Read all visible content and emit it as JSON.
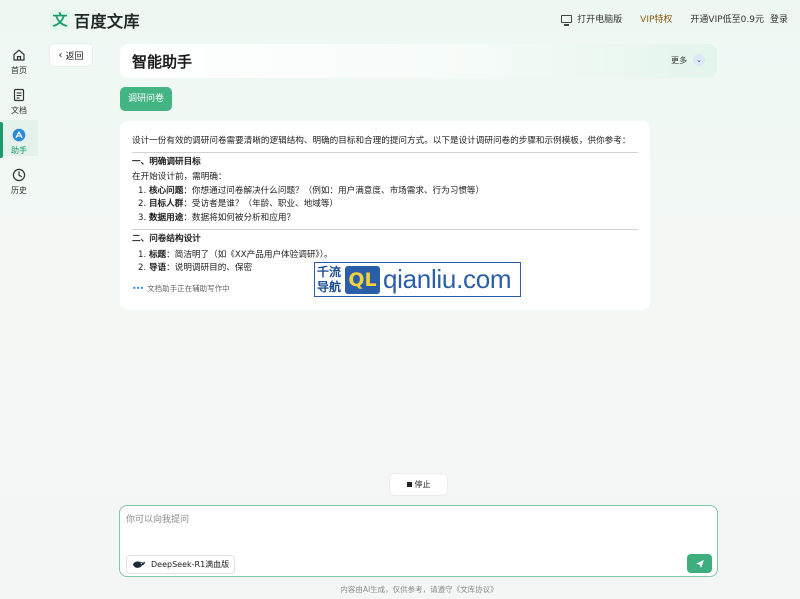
{
  "header": {
    "logo_mark": "文",
    "logo_text": "百度文库",
    "open_pc": "打开电脑版",
    "vip_privilege": "VIP特权",
    "vip_offer": "开通VIP低至0.9元",
    "login": "登录"
  },
  "sidebar": {
    "items": [
      {
        "label": "首页",
        "icon": "home-icon"
      },
      {
        "label": "文档",
        "icon": "document-icon"
      },
      {
        "label": "助手",
        "icon": "assistant-icon",
        "active": true
      },
      {
        "label": "历史",
        "icon": "history-icon"
      }
    ]
  },
  "back_label": "返回",
  "page_title": "智能助手",
  "more_label": "更多",
  "survey_tag": "调研问卷",
  "response": {
    "intro": "设计一份有效的调研问卷需要清晰的逻辑结构、明确的目标和合理的提问方式。以下是设计调研问卷的步骤和示例模板，供你参考：",
    "section1_title": "一、明确调研目标",
    "section1_lead": "在开始设计前，需明确：",
    "section1_items": [
      {
        "num": "1.",
        "term": "核心问题",
        "text": "：你想通过问卷解决什么问题？（例如：用户满意度、市场需求、行为习惯等）"
      },
      {
        "num": "2.",
        "term": "目标人群",
        "text": "：受访者是谁？（年龄、职业、地域等）"
      },
      {
        "num": "3.",
        "term": "数据用途",
        "text": "：数据将如何被分析和应用？"
      }
    ],
    "section2_title": "二、问卷结构设计",
    "section2_items": [
      {
        "num": "1.",
        "term": "标题",
        "text": "：简洁明了（如《XX产品用户体验调研》）。"
      },
      {
        "num": "2.",
        "term": "导语",
        "text": "：说明调研目的、保密"
      }
    ],
    "writing_status": "文档助手正在辅助写作中"
  },
  "watermark": {
    "cn_line1": "千流",
    "cn_line2": "导航",
    "logo": "QL",
    "url": "qianliu.com"
  },
  "stop_label": "停止",
  "input": {
    "placeholder": "你可以向我提问",
    "model": "DeepSeek-R1满血版"
  },
  "footer_note": "内容由AI生成，仅供参考，请遵守《文库协议》",
  "colors": {
    "accent": "#1c9b6a",
    "tag_bg": "#43b484",
    "send_bg": "#3fae7f",
    "watermark_blue": "#2a5ea8"
  }
}
